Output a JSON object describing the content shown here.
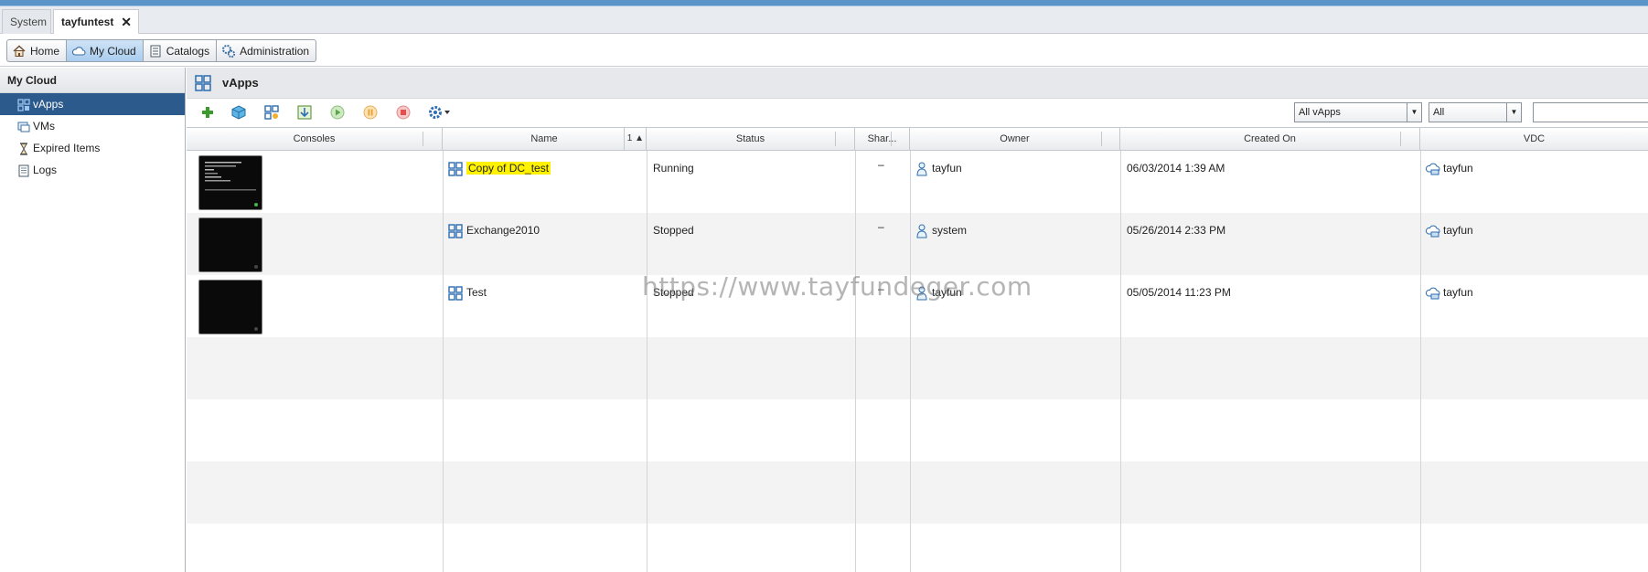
{
  "org_tabs": [
    {
      "label": "System"
    },
    {
      "label": "tayfuntest",
      "close": "✕"
    }
  ],
  "nav": {
    "home": "Home",
    "my_cloud": "My Cloud",
    "catalogs": "Catalogs",
    "administration": "Administration"
  },
  "sidebar": {
    "title": "My Cloud",
    "items": [
      {
        "label": "vApps",
        "icon": "vapp-icon",
        "selected": true
      },
      {
        "label": "VMs",
        "icon": "vm-icon"
      },
      {
        "label": "Expired Items",
        "icon": "hourglass-icon"
      },
      {
        "label": "Logs",
        "icon": "logs-icon"
      }
    ]
  },
  "main": {
    "title": "vApps"
  },
  "toolbar": {
    "filter1": "All vApps",
    "filter2": "All",
    "search_value": ""
  },
  "grid": {
    "columns": {
      "consoles": "Consoles",
      "name": "Name",
      "sort_indicator": "1 ▲",
      "status": "Status",
      "shared": "Shar...",
      "owner": "Owner",
      "created_on": "Created On",
      "vdc": "VDC"
    },
    "rows": [
      {
        "name": "Copy of DC_test",
        "status": "Running",
        "shared": "–",
        "owner": "tayfun",
        "created_on": "06/03/2014 1:39 AM",
        "vdc": "tayfun"
      },
      {
        "name": "Exchange2010",
        "status": "Stopped",
        "shared": "–",
        "owner": "system",
        "created_on": "05/26/2014 2:33 PM",
        "vdc": "tayfun"
      },
      {
        "name": "Test",
        "status": "Stopped",
        "shared": "–",
        "owner": "tayfun",
        "created_on": "05/05/2014 11:23 PM",
        "vdc": "tayfun"
      }
    ]
  },
  "watermark": "https://www.tayfundeger.com",
  "colors": {
    "accent_blue": "#2d5a8c",
    "highlight": "#fff200",
    "running_green": "#4caf50"
  }
}
